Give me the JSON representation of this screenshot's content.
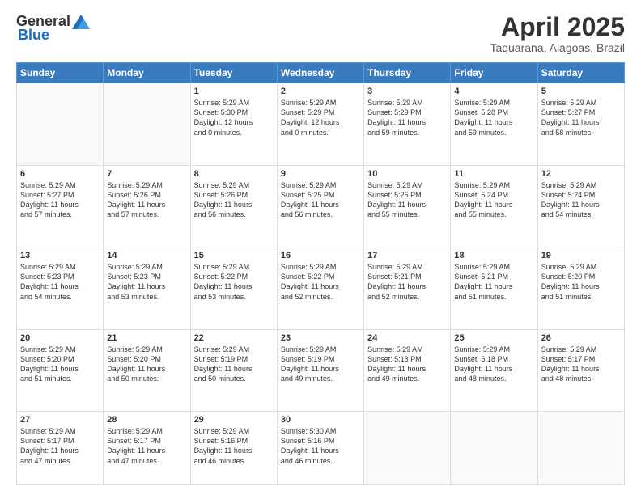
{
  "logo": {
    "general": "General",
    "blue": "Blue"
  },
  "header": {
    "title": "April 2025",
    "subtitle": "Taquarana, Alagoas, Brazil"
  },
  "weekdays": [
    "Sunday",
    "Monday",
    "Tuesday",
    "Wednesday",
    "Thursday",
    "Friday",
    "Saturday"
  ],
  "weeks": [
    [
      {
        "day": "",
        "content": ""
      },
      {
        "day": "",
        "content": ""
      },
      {
        "day": "1",
        "content": "Sunrise: 5:29 AM\nSunset: 5:30 PM\nDaylight: 12 hours\nand 0 minutes."
      },
      {
        "day": "2",
        "content": "Sunrise: 5:29 AM\nSunset: 5:29 PM\nDaylight: 12 hours\nand 0 minutes."
      },
      {
        "day": "3",
        "content": "Sunrise: 5:29 AM\nSunset: 5:29 PM\nDaylight: 11 hours\nand 59 minutes."
      },
      {
        "day": "4",
        "content": "Sunrise: 5:29 AM\nSunset: 5:28 PM\nDaylight: 11 hours\nand 59 minutes."
      },
      {
        "day": "5",
        "content": "Sunrise: 5:29 AM\nSunset: 5:27 PM\nDaylight: 11 hours\nand 58 minutes."
      }
    ],
    [
      {
        "day": "6",
        "content": "Sunrise: 5:29 AM\nSunset: 5:27 PM\nDaylight: 11 hours\nand 57 minutes."
      },
      {
        "day": "7",
        "content": "Sunrise: 5:29 AM\nSunset: 5:26 PM\nDaylight: 11 hours\nand 57 minutes."
      },
      {
        "day": "8",
        "content": "Sunrise: 5:29 AM\nSunset: 5:26 PM\nDaylight: 11 hours\nand 56 minutes."
      },
      {
        "day": "9",
        "content": "Sunrise: 5:29 AM\nSunset: 5:25 PM\nDaylight: 11 hours\nand 56 minutes."
      },
      {
        "day": "10",
        "content": "Sunrise: 5:29 AM\nSunset: 5:25 PM\nDaylight: 11 hours\nand 55 minutes."
      },
      {
        "day": "11",
        "content": "Sunrise: 5:29 AM\nSunset: 5:24 PM\nDaylight: 11 hours\nand 55 minutes."
      },
      {
        "day": "12",
        "content": "Sunrise: 5:29 AM\nSunset: 5:24 PM\nDaylight: 11 hours\nand 54 minutes."
      }
    ],
    [
      {
        "day": "13",
        "content": "Sunrise: 5:29 AM\nSunset: 5:23 PM\nDaylight: 11 hours\nand 54 minutes."
      },
      {
        "day": "14",
        "content": "Sunrise: 5:29 AM\nSunset: 5:23 PM\nDaylight: 11 hours\nand 53 minutes."
      },
      {
        "day": "15",
        "content": "Sunrise: 5:29 AM\nSunset: 5:22 PM\nDaylight: 11 hours\nand 53 minutes."
      },
      {
        "day": "16",
        "content": "Sunrise: 5:29 AM\nSunset: 5:22 PM\nDaylight: 11 hours\nand 52 minutes."
      },
      {
        "day": "17",
        "content": "Sunrise: 5:29 AM\nSunset: 5:21 PM\nDaylight: 11 hours\nand 52 minutes."
      },
      {
        "day": "18",
        "content": "Sunrise: 5:29 AM\nSunset: 5:21 PM\nDaylight: 11 hours\nand 51 minutes."
      },
      {
        "day": "19",
        "content": "Sunrise: 5:29 AM\nSunset: 5:20 PM\nDaylight: 11 hours\nand 51 minutes."
      }
    ],
    [
      {
        "day": "20",
        "content": "Sunrise: 5:29 AM\nSunset: 5:20 PM\nDaylight: 11 hours\nand 51 minutes."
      },
      {
        "day": "21",
        "content": "Sunrise: 5:29 AM\nSunset: 5:20 PM\nDaylight: 11 hours\nand 50 minutes."
      },
      {
        "day": "22",
        "content": "Sunrise: 5:29 AM\nSunset: 5:19 PM\nDaylight: 11 hours\nand 50 minutes."
      },
      {
        "day": "23",
        "content": "Sunrise: 5:29 AM\nSunset: 5:19 PM\nDaylight: 11 hours\nand 49 minutes."
      },
      {
        "day": "24",
        "content": "Sunrise: 5:29 AM\nSunset: 5:18 PM\nDaylight: 11 hours\nand 49 minutes."
      },
      {
        "day": "25",
        "content": "Sunrise: 5:29 AM\nSunset: 5:18 PM\nDaylight: 11 hours\nand 48 minutes."
      },
      {
        "day": "26",
        "content": "Sunrise: 5:29 AM\nSunset: 5:17 PM\nDaylight: 11 hours\nand 48 minutes."
      }
    ],
    [
      {
        "day": "27",
        "content": "Sunrise: 5:29 AM\nSunset: 5:17 PM\nDaylight: 11 hours\nand 47 minutes."
      },
      {
        "day": "28",
        "content": "Sunrise: 5:29 AM\nSunset: 5:17 PM\nDaylight: 11 hours\nand 47 minutes."
      },
      {
        "day": "29",
        "content": "Sunrise: 5:29 AM\nSunset: 5:16 PM\nDaylight: 11 hours\nand 46 minutes."
      },
      {
        "day": "30",
        "content": "Sunrise: 5:30 AM\nSunset: 5:16 PM\nDaylight: 11 hours\nand 46 minutes."
      },
      {
        "day": "",
        "content": ""
      },
      {
        "day": "",
        "content": ""
      },
      {
        "day": "",
        "content": ""
      }
    ]
  ]
}
